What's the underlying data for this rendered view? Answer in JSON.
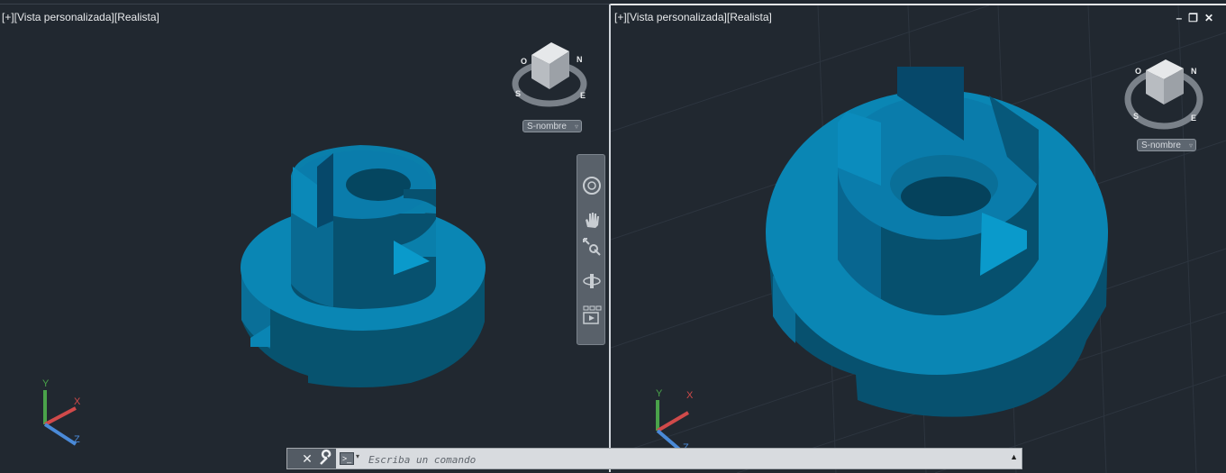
{
  "left_viewport": {
    "label": "[+][Vista personalizada][Realista]",
    "viewcube": {
      "compass": {
        "n": "N",
        "s": "S",
        "e": "E",
        "w": "O"
      }
    },
    "named_view": "S-nombre"
  },
  "right_viewport": {
    "label": "[+][Vista personalizada][Realista]",
    "viewcube": {
      "compass": {
        "n": "N",
        "s": "S",
        "e": "E",
        "w": "O"
      }
    },
    "named_view": "S-nombre",
    "controls": {
      "minimize": "–",
      "restore": "❐",
      "close": "✕"
    }
  },
  "ucs": {
    "x": "X",
    "y": "Y",
    "z": "Z"
  },
  "command_line": {
    "close": "✕",
    "prompt_icon": ">_",
    "prompt_arrow": "▾",
    "placeholder": "Escriba un comando",
    "history_arrow": "▲"
  },
  "colors": {
    "background": "#212830",
    "model_light": "#0a86b4",
    "model_mid": "#0a6f98",
    "model_dark": "#07516f",
    "ucs_x": "#d04a4a",
    "ucs_y": "#4aa34a",
    "ucs_z": "#4a8ad8"
  }
}
